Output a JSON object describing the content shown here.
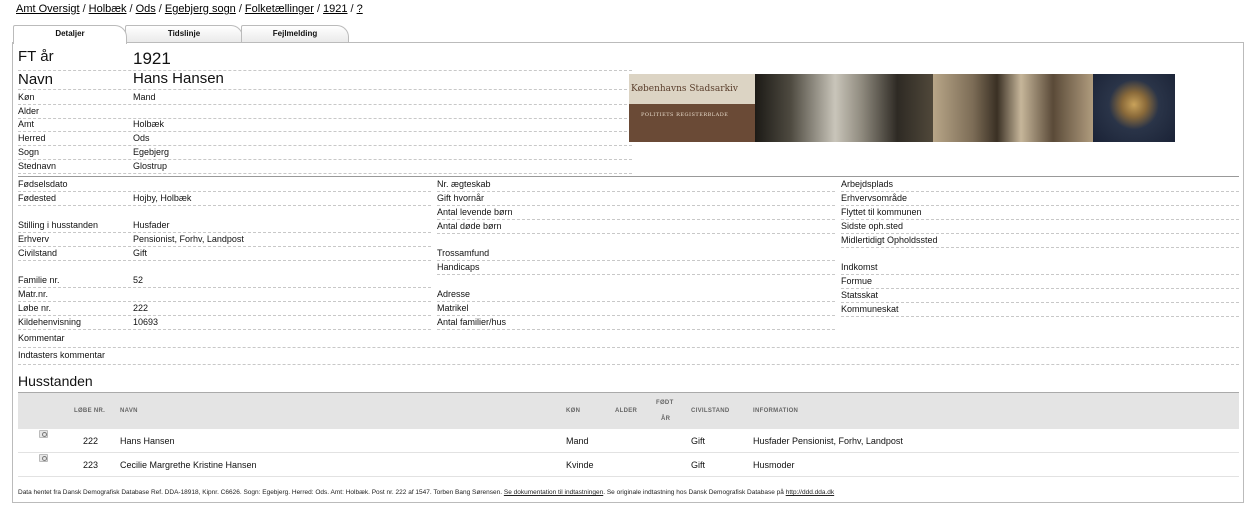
{
  "breadcrumb": [
    "Amt Oversigt",
    "Holbæk",
    "Ods",
    "Egebjerg sogn",
    "Folketællinger",
    "1921",
    "?"
  ],
  "tabs": [
    "Detaljer",
    "Tidslinje",
    "Fejlmelding"
  ],
  "header": {
    "ft_label": "FT år",
    "ft_value": "1921",
    "name_label": "Navn",
    "name_value": "Hans Hansen"
  },
  "top_fields": [
    {
      "label": "Køn",
      "value": "Mand"
    },
    {
      "label": "Alder",
      "value": ""
    },
    {
      "label": "Amt",
      "value": "Holbæk"
    },
    {
      "label": "Herred",
      "value": "Ods"
    },
    {
      "label": "Sogn",
      "value": "Egebjerg"
    },
    {
      "label": "Stednavn",
      "value": "Glostrup"
    }
  ],
  "banner": {
    "title": "Københavns Stadsarkiv",
    "subtitle": "POLITIETS REGISTERBLADE"
  },
  "col1": [
    {
      "label": "Fødselsdato",
      "value": ""
    },
    {
      "label": "Fødested",
      "value": "Hojby, Holbæk"
    },
    {
      "label": "Stilling i husstanden",
      "value": "Husfader"
    },
    {
      "label": "Erhverv",
      "value": "Pensionist, Forhv, Landpost"
    },
    {
      "label": "Civilstand",
      "value": "Gift"
    },
    {
      "label": "Familie nr.",
      "value": "52"
    },
    {
      "label": "Matr.nr.",
      "value": ""
    },
    {
      "label": "Løbe nr.",
      "value": "222"
    },
    {
      "label": "Kildehenvisning",
      "value": "10693"
    }
  ],
  "col2": [
    "Nr. ægteskab",
    "Gift hvornår",
    "Antal levende børn",
    "Antal døde børn",
    "Trossamfund",
    "Handicaps",
    "Adresse",
    "Matrikel",
    "Antal familier/hus"
  ],
  "col3": [
    "Arbejdsplads",
    "Erhvervsområde",
    "Flyttet til kommunen",
    "Sidste oph.sted",
    "Midlertidigt Opholdssted",
    "Indkomst",
    "Formue",
    "Statsskat",
    "Kommuneskat"
  ],
  "comments": {
    "kommentar": "Kommentar",
    "indtaster": "Indtasters kommentar"
  },
  "household": {
    "title": "Husstanden",
    "headers": {
      "lobe": "LØBE NR.",
      "navn": "NAVN",
      "kon": "KØN",
      "alder": "ALDER",
      "fodt1": "FØDT",
      "fodt2": "ÅR",
      "civil": "CIVILSTAND",
      "info": "INFORMATION"
    },
    "rows": [
      {
        "lobe": "222",
        "navn": "Hans Hansen",
        "kon": "Mand",
        "alder": "",
        "fodt": "",
        "civil": "Gift",
        "info": "Husfader Pensionist, Forhv, Landpost"
      },
      {
        "lobe": "223",
        "navn": "Cecilie Margrethe Kristine Hansen",
        "kon": "Kvinde",
        "alder": "",
        "fodt": "",
        "civil": "Gift",
        "info": "Husmoder"
      }
    ]
  },
  "footer": {
    "text": "Data hentet fra Dansk Demografisk Database Ref. DDA-18918, Kipnr. C6626. Sogn: Egebjerg. Herred: Ods. Amt: Holbæk. Post nr. 222 af 1547. Torben Bang Sørensen.",
    "link1": "Se dokumentation til indtastningen",
    "mid": ". Se originale indtastning hos Dansk Demografisk Database på",
    "link2": "http://ddd.dda.dk"
  }
}
